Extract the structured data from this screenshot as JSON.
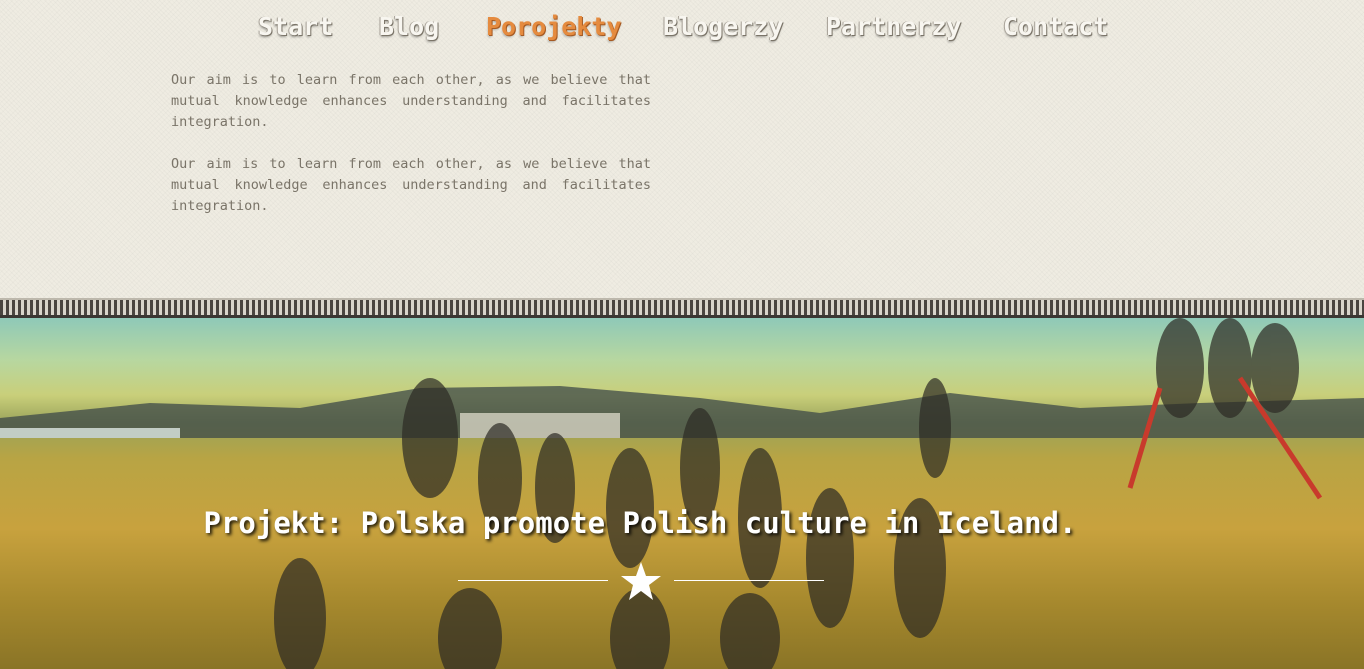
{
  "nav": {
    "items": [
      {
        "label": "Start",
        "active": false
      },
      {
        "label": "Blog",
        "active": false
      },
      {
        "label": "Porojekty",
        "active": true
      },
      {
        "label": "Blogerzy",
        "active": false
      },
      {
        "label": "Partnerzy",
        "active": false
      },
      {
        "label": "Contact",
        "active": false
      }
    ],
    "active_color": "#e58b3f",
    "text_color": "#f8f6f0"
  },
  "content": {
    "paragraphs": [
      "Our aim is to learn from each other, as we believe that mutual knowledge enhances understanding and facilitates integration.",
      "Our aim is to learn from each other, as we believe that mutual knowledge enhances understanding and facilitates integration."
    ]
  },
  "hero": {
    "caption": "Projekt: Polska promote Polish culture in Iceland.",
    "icon": "star-icon"
  }
}
